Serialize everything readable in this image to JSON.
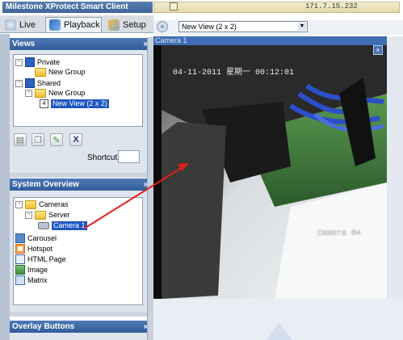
{
  "window": {
    "title": "Milestone XProtect Smart Client",
    "address": "171.7.15.232"
  },
  "tabs": [
    {
      "label": "Live"
    },
    {
      "label": "Playback"
    },
    {
      "label": "Setup"
    }
  ],
  "views_panel": {
    "title": "Views",
    "tree": {
      "private": "Private",
      "private_group": "New Group",
      "shared": "Shared",
      "shared_group": "New Group",
      "selected_view_layout": "4",
      "selected_view": "New View (2 x 2)"
    },
    "shortcut_label": "Shortcut:",
    "shortcut_value": ""
  },
  "system_overview": {
    "title": "System Overview",
    "items": {
      "cameras": "Cameras",
      "server": "Server",
      "camera1": "Camera 1",
      "carousel": "Carousel",
      "hotspot": "Hotspot",
      "html_page": "HTML Page",
      "image": "Image",
      "matrix": "Matrix"
    }
  },
  "overlay_panel": {
    "title": "Overlay Buttons"
  },
  "view_selector": {
    "selected": "New View (2 x 2)"
  },
  "camera_tile": {
    "title": "Camera 1",
    "osd_timestamp": "04-11-2011 星期一 00:12:01",
    "osd_name": "Camera 04"
  },
  "colors": {
    "panel_header": "#3f6ba8",
    "selection": "#1f57c4",
    "annotation_arrow": "#e0201c"
  }
}
